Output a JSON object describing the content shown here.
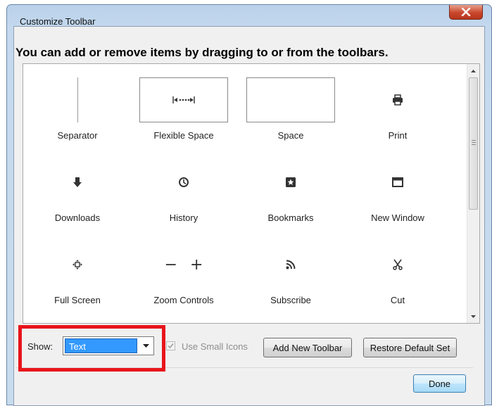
{
  "window": {
    "title": "Customize Toolbar",
    "close_icon": "close-icon"
  },
  "instructions": "You can add or remove items by dragging to or from the toolbars.",
  "palette": {
    "items": [
      {
        "label": "Separator",
        "icon": "separator-line"
      },
      {
        "label": "Flexible Space",
        "icon": "flexible-space-icon"
      },
      {
        "label": "Space",
        "icon": "space-box"
      },
      {
        "label": "Print",
        "icon": "print-icon"
      },
      {
        "label": "Downloads",
        "icon": "download-icon"
      },
      {
        "label": "History",
        "icon": "clock-icon"
      },
      {
        "label": "Bookmarks",
        "icon": "bookmark-star-icon"
      },
      {
        "label": "New Window",
        "icon": "new-window-icon"
      },
      {
        "label": "Full Screen",
        "icon": "fullscreen-icon"
      },
      {
        "label": "Zoom Controls",
        "icon": "zoom-controls-icon"
      },
      {
        "label": "Subscribe",
        "icon": "rss-icon"
      },
      {
        "label": "Cut",
        "icon": "scissors-icon"
      }
    ],
    "zoom_minus": "−",
    "zoom_plus": "+"
  },
  "controls": {
    "show_label": "Show:",
    "show_value": "Text",
    "small_icons_label": "Use Small Icons",
    "small_icons_checked": true,
    "small_icons_enabled": false,
    "add_toolbar_label": "Add New Toolbar",
    "restore_label": "Restore Default Set",
    "done_label": "Done"
  },
  "colors": {
    "highlight": "#e8141b",
    "selection": "#3399ff"
  }
}
